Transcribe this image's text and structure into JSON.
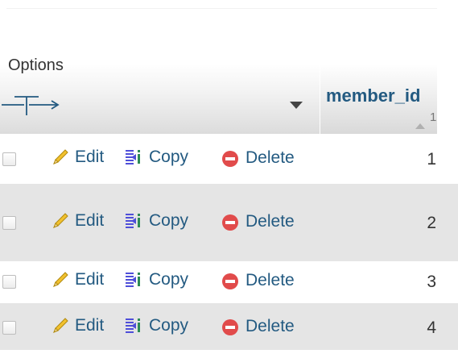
{
  "header": {
    "options_label": "Options",
    "column": {
      "name": "member_id",
      "sort_order": "1"
    }
  },
  "rows": [
    {
      "edit": "Edit",
      "copy": "Copy",
      "delete": "Delete",
      "member_id": "1"
    },
    {
      "edit": "Edit",
      "copy": "Copy",
      "delete": "Delete",
      "member_id": "2"
    },
    {
      "edit": "Edit",
      "copy": "Copy",
      "delete": "Delete",
      "member_id": "3"
    },
    {
      "edit": "Edit",
      "copy": "Copy",
      "delete": "Delete",
      "member_id": "4"
    }
  ],
  "icons": {
    "options_toggle": "tee-arrow-icon",
    "sort_dropdown": "triangle-down-icon",
    "sort_direction": "sort-ascending-icon",
    "edit": "pencil-icon",
    "copy": "copy-icon",
    "delete": "delete-icon"
  },
  "colors": {
    "link": "#235a81",
    "row_even": "#e5e5e5",
    "header_gradient_end": "#dcdcdc",
    "delete_red": "#e14b4b",
    "pencil_yellow": "#f2c12e",
    "copy_blue": "#4f4fd9"
  }
}
